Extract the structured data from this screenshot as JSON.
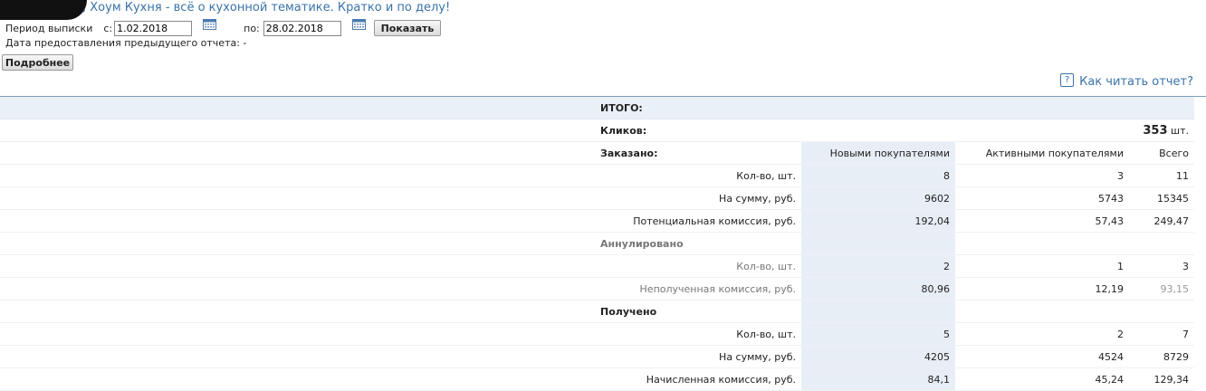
{
  "header": {
    "title": ", Хоум Кухня - всё о кухонной тематике. Кратко и по делу!"
  },
  "period": {
    "label": "Период выписки",
    "from_label": "с:",
    "from_value": "1.02.2018",
    "to_label": "по:",
    "to_value": "28.02.2018",
    "show_button": "Показать"
  },
  "prev_report": {
    "text": "Дата предоставления предыдущего отчета: -"
  },
  "more_button": "Подробнее",
  "help_link": "Как читать отчет?",
  "report": {
    "total_label": "ИТОГО:",
    "clicks_label": "Кликов:",
    "clicks_value": "353",
    "clicks_unit": "шт.",
    "ordered": {
      "label": "Заказано:",
      "col_new": "Новыми покупателями",
      "col_active": "Активными покупателями",
      "col_total": "Всего",
      "rows": [
        {
          "label": "Кол-во, шт.",
          "new": "8",
          "active": "3",
          "total": "11"
        },
        {
          "label": "На сумму, руб.",
          "new": "9602",
          "active": "5743",
          "total": "15345"
        },
        {
          "label": "Потенциальная комиссия, руб.",
          "new": "192,04",
          "active": "57,43",
          "total": "249,47"
        }
      ]
    },
    "cancelled": {
      "label": "Аннулировано",
      "rows": [
        {
          "label": "Кол-во, шт.",
          "new": "2",
          "active": "1",
          "total": "3"
        },
        {
          "label": "Неполученная комиссия, руб.",
          "new": "80,96",
          "active": "12,19",
          "total": "93,15"
        }
      ]
    },
    "received": {
      "label": "Получено",
      "rows": [
        {
          "label": "Кол-во, шт.",
          "new": "5",
          "active": "2",
          "total": "7"
        },
        {
          "label": "На сумму, руб.",
          "new": "4205",
          "active": "4524",
          "total": "8729"
        },
        {
          "label": "Начисленная комиссия, руб.",
          "new": "84,1",
          "active": "45,24",
          "total": "129,34"
        }
      ]
    }
  },
  "icons": {
    "calendar": "calendar-icon",
    "help": "help-icon"
  },
  "colors": {
    "link": "#3a73a8",
    "highlight_column": "#e8eef6",
    "total_row": "#eaf0f8"
  }
}
